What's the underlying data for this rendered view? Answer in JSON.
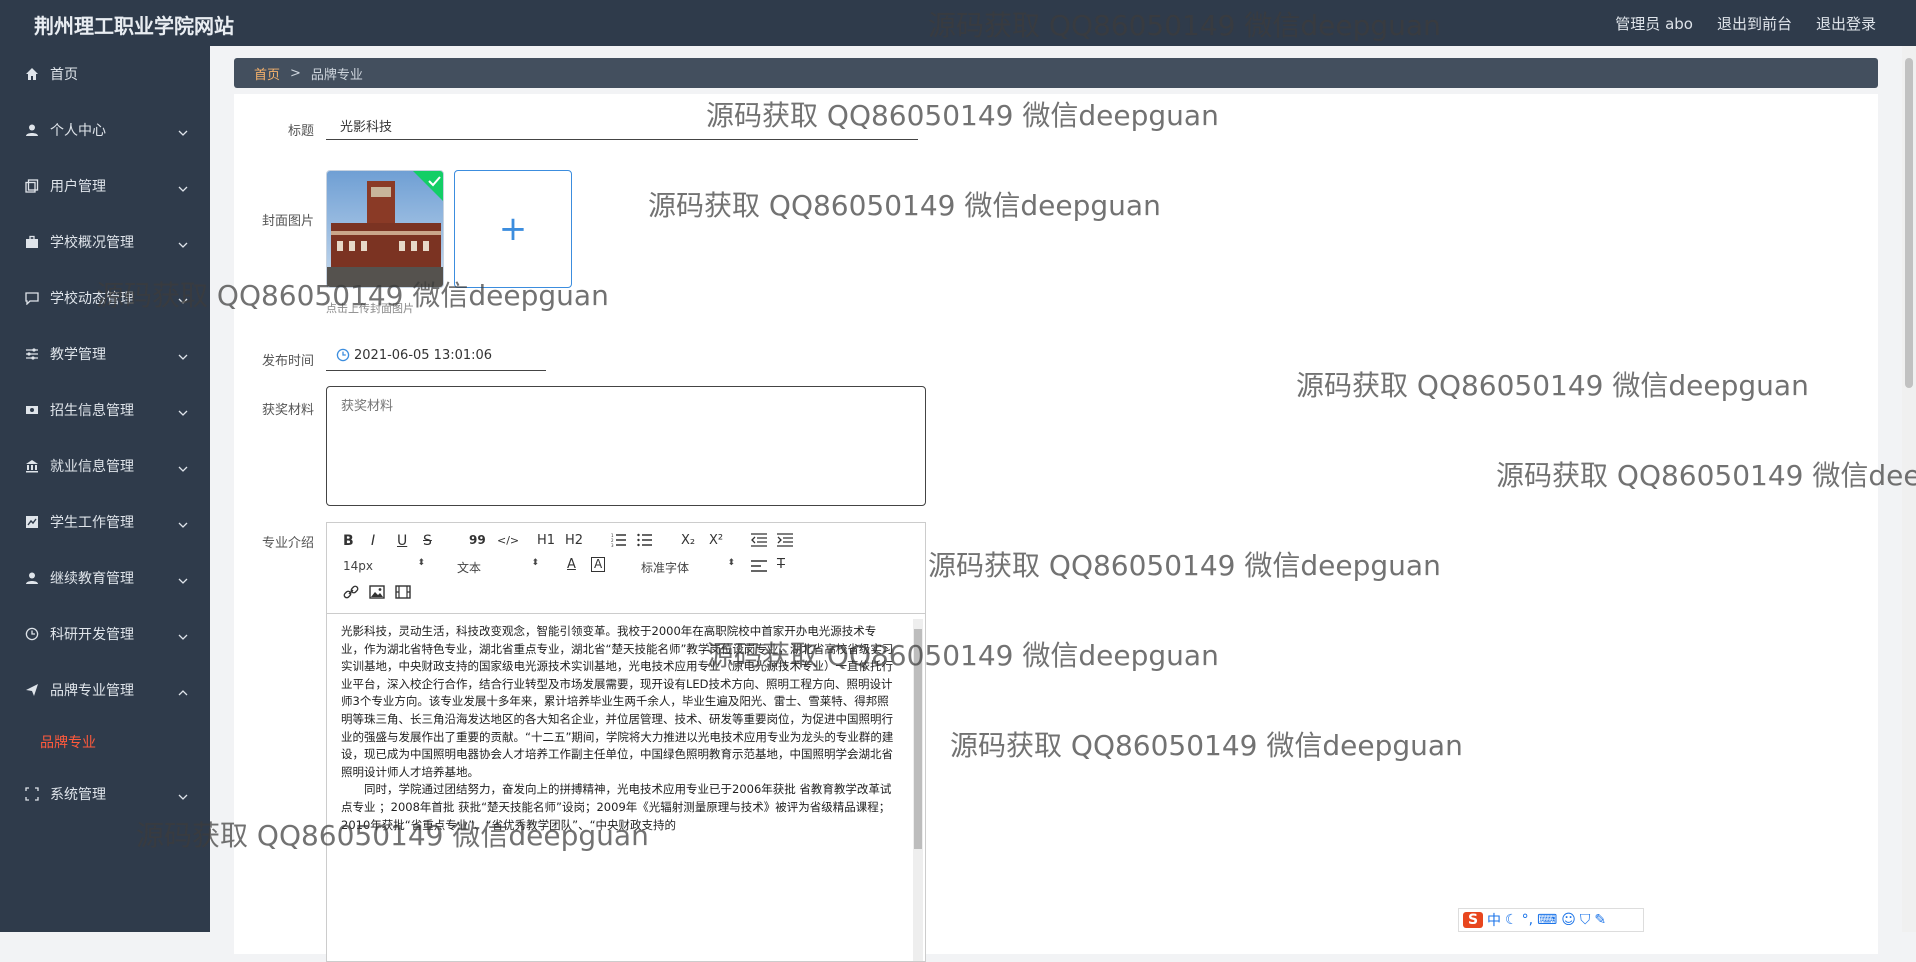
{
  "header": {
    "site_title": "荆州理工职业学院网站",
    "admin_label": "管理员 abo",
    "exit_front": "退出到前台",
    "logout": "退出登录"
  },
  "sidebar": {
    "items": [
      {
        "label": "首页",
        "icon": "home-icon"
      },
      {
        "label": "个人中心",
        "icon": "user-icon"
      },
      {
        "label": "用户管理",
        "icon": "copy-icon"
      },
      {
        "label": "学校概况管理",
        "icon": "briefcase-icon"
      },
      {
        "label": "学校动态管理",
        "icon": "chat-icon"
      },
      {
        "label": "教学管理",
        "icon": "sliders-icon"
      },
      {
        "label": "招生信息管理",
        "icon": "ticket-icon"
      },
      {
        "label": "就业信息管理",
        "icon": "bank-icon"
      },
      {
        "label": "学生工作管理",
        "icon": "chart-icon"
      },
      {
        "label": "继续教育管理",
        "icon": "person-icon"
      },
      {
        "label": "科研开发管理",
        "icon": "clock-icon"
      },
      {
        "label": "品牌专业管理",
        "icon": "send-icon"
      },
      {
        "label": "系统管理",
        "icon": "frame-icon"
      }
    ],
    "sub_item": "品牌专业"
  },
  "breadcrumb": {
    "home": "首页",
    "separator": ">",
    "current": "品牌专业"
  },
  "form": {
    "title_label": "标题",
    "title_value": "光影科技",
    "cover_label": "封面图片",
    "cover_hint": "点击上传封面图片",
    "upload_plus": "+",
    "publish_label": "发布时间",
    "publish_value": "2021-06-05 13:01:06",
    "award_label": "获奖材料",
    "award_placeholder": "获奖材料",
    "intro_label": "专业介绍"
  },
  "editor": {
    "toolbar": {
      "bold": "B",
      "italic": "I",
      "underline": "U",
      "strike": "S",
      "quote": "99",
      "code": "</>",
      "h1": "H1",
      "h2": "H2",
      "sub": "X₂",
      "sup": "X²",
      "font_size": "14px",
      "text_type": "文本",
      "font_family": "标准字体"
    },
    "paragraphs": [
      "光影科技，灵动生活，科技改变观念，智能引领变革。我校于2000年在高职院校中首家开办电光源技术专业，作为湖北省特色专业，湖北省重点专业，湖北省“楚天技能名师”教学岗位设岗专业，湖北省高校省级实习实训基地，中央财政支持的国家级电光源技术实训基地，光电技术应用专业（原电光源技术专业）一直依托行业平台，深入校企行合作，结合行业转型及市场发展需要，现开设有LED技术方向、照明工程方向、照明设计师3个专业方向。该专业发展十多年来，累计培养毕业生两千余人，毕业生遍及阳光、雷士、雪莱特、得邦照明等珠三角、长三角沿海发达地区的各大知名企业，并位居管理、技术、研发等重要岗位，为促进中国照明行业的强盛与发展作出了重要的贡献。“十二五”期间，学院将大力推进以光电技术应用专业为龙头的专业群的建设，现已成为中国照明电器协会人才培养工作副主任单位，中国绿色照明教育示范基地，中国照明学会湖北省照明设计师人才培养基地。",
      "同时，学院通过团结努力，奋发向上的拼搏精神，光电技术应用专业已于2006年获批 省教育教学改革试点专业 ；2008年首批 获批“楚天技能名师”设岗；2009年《光辐射测量原理与技术》被评为省级精品课程；2010年获批“省重点专业”、“省优秀教学团队”、“中央财政支持的"
    ]
  },
  "watermark": "源码获取 QQ86050149 微信deepguan",
  "ime": {
    "logo": "S",
    "lang": "中"
  }
}
